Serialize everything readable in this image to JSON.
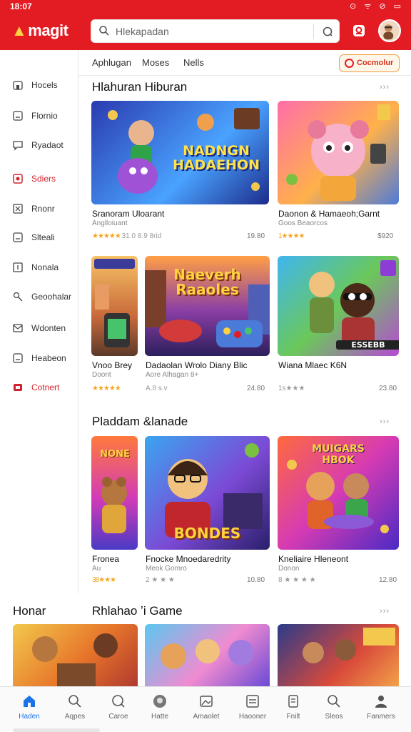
{
  "status": {
    "time": "18:07",
    "icons": "⊙ ᯤ ⊘ ▭"
  },
  "app": {
    "logo": "magit",
    "search_placeholder": "Hlekapadan"
  },
  "subtabs": [
    "Aphlugan",
    "Moses",
    "Nells"
  ],
  "connect_label": "Cocmolur",
  "sidebar": [
    {
      "label": "Hocels",
      "icon": "home-icon"
    },
    {
      "label": "Flornio",
      "icon": "window-icon"
    },
    {
      "label": "Ryadaot",
      "icon": "chat-icon"
    },
    {
      "label": "Sdiers",
      "icon": "store-icon"
    },
    {
      "label": "Rnonr",
      "icon": "puzzle-icon"
    },
    {
      "label": "Slteali",
      "icon": "window-icon"
    },
    {
      "label": "Nonala",
      "icon": "note-icon"
    },
    {
      "label": "Geoohalar",
      "icon": "pin-icon"
    },
    {
      "label": "Wdonten",
      "icon": "mail-icon"
    },
    {
      "label": "Heabeon",
      "icon": "window-icon"
    },
    {
      "label": "Cotnert",
      "icon": "tv-icon"
    }
  ],
  "sections": [
    {
      "title": "Hlahuran Hiburan",
      "more": "›››"
    },
    {
      "title": "Pladdam &lanade",
      "more": "›››"
    },
    {
      "title": "Rhlahao ʼi Game",
      "more": "›››"
    }
  ],
  "side_section_label": "Honar",
  "cards": [
    {
      "title": "Sranoram Uloarant",
      "sub": "Anglloiuant",
      "stars": "★★★★★",
      "rest": "31.0 8.9 8rid",
      "price": "19.80",
      "art": "NADNGN\nHADAEHON"
    },
    {
      "title": "Daonon & Hamaeoh;Garnt",
      "sub": "Goos Beaorcos",
      "stars": "1★★★★",
      "rest": "",
      "price": "$920",
      "art": ""
    },
    {
      "title": "Vnoo Brey",
      "sub": "Doont",
      "stars": "★★★★★",
      "rest": "",
      "price": "",
      "art": ""
    },
    {
      "title": "Dadaolan Wrolo Diany Blic",
      "sub": "Aore Alhagan 8+",
      "stars": "",
      "rest": "A.8 s.v",
      "price": "24.80",
      "art": "Naeverh\nRaaoles"
    },
    {
      "title": "Wiana Mlaec K6N",
      "sub": "",
      "stars": "",
      "rest": "1s★★★",
      "price": "23.80",
      "art": "ESSEBB"
    },
    {
      "title": "Fronea",
      "sub": "Au",
      "stars": "38★★★",
      "rest": "",
      "price": "",
      "art": "NONE"
    },
    {
      "title": "Fnocke Mnoedaredrity",
      "sub": "Meok Gomro",
      "stars": "",
      "rest": "2 ★ ★ ★",
      "price": "10.80",
      "art": "BONDES"
    },
    {
      "title": "Kneliaire Hleneont",
      "sub": "Donon",
      "stars": "",
      "rest": "8 ★ ★ ★ ★",
      "price": "12.80",
      "art": "MUIGARS\nHBOK"
    }
  ],
  "bottom_nav": [
    {
      "label": "Haden",
      "icon": "home-icon",
      "active": true
    },
    {
      "label": "Aqpes",
      "icon": "search-icon"
    },
    {
      "label": "Caroe",
      "icon": "search-icon"
    },
    {
      "label": "Hatte",
      "icon": "avatar-icon"
    },
    {
      "label": "Amaolet",
      "icon": "image-icon"
    },
    {
      "label": "Haooner",
      "icon": "window-icon"
    },
    {
      "label": "Fnilt",
      "icon": "document-icon"
    },
    {
      "label": "Sleos",
      "icon": "search-icon"
    },
    {
      "label": "Fanmers",
      "icon": "person-icon"
    }
  ],
  "colors": {
    "brand": "#e31b23",
    "accent": "#1a73e8",
    "star": "#f5a623"
  }
}
